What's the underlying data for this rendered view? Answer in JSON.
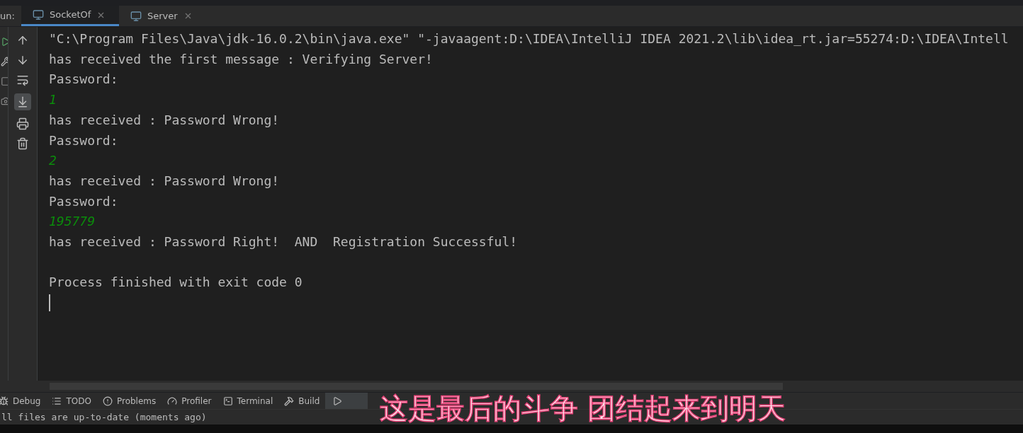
{
  "run_panel": {
    "label": "un:",
    "tabs": [
      {
        "label": "SocketOf",
        "selected": true
      },
      {
        "label": "Server",
        "selected": false
      }
    ]
  },
  "console": {
    "lines": [
      {
        "kind": "output",
        "text": "\"C:\\Program Files\\Java\\jdk-16.0.2\\bin\\java.exe\" \"-javaagent:D:\\IDEA\\IntelliJ IDEA 2021.2\\lib\\idea_rt.jar=55274:D:\\IDEA\\Intell"
      },
      {
        "kind": "output",
        "text": "has received the first message : Verifying Server!"
      },
      {
        "kind": "output",
        "text": "Password:"
      },
      {
        "kind": "input",
        "text": "1"
      },
      {
        "kind": "output",
        "text": "has received : Password Wrong!"
      },
      {
        "kind": "output",
        "text": "Password:"
      },
      {
        "kind": "input",
        "text": "2"
      },
      {
        "kind": "output",
        "text": "has received : Password Wrong!"
      },
      {
        "kind": "output",
        "text": "Password:"
      },
      {
        "kind": "input",
        "text": "195779"
      },
      {
        "kind": "output",
        "text": "has received : Password Right!  AND  Registration Successful!"
      },
      {
        "kind": "blank"
      },
      {
        "kind": "output",
        "text": "Process finished with exit code 0"
      },
      {
        "kind": "cursor"
      }
    ]
  },
  "tool_window_bar": [
    {
      "label": "Debug",
      "selected": false
    },
    {
      "label": "TODO",
      "selected": false
    },
    {
      "label": "Problems",
      "selected": false
    },
    {
      "label": "Profiler",
      "selected": false
    },
    {
      "label": "Terminal",
      "selected": false
    },
    {
      "label": "Build",
      "selected": false
    },
    {
      "selected": true
    }
  ],
  "status_bar": {
    "text": "ll files are up-to-date (moments ago)"
  },
  "lyrics_overlay": {
    "text": "这是最后的斗争 团结起来到明天"
  }
}
